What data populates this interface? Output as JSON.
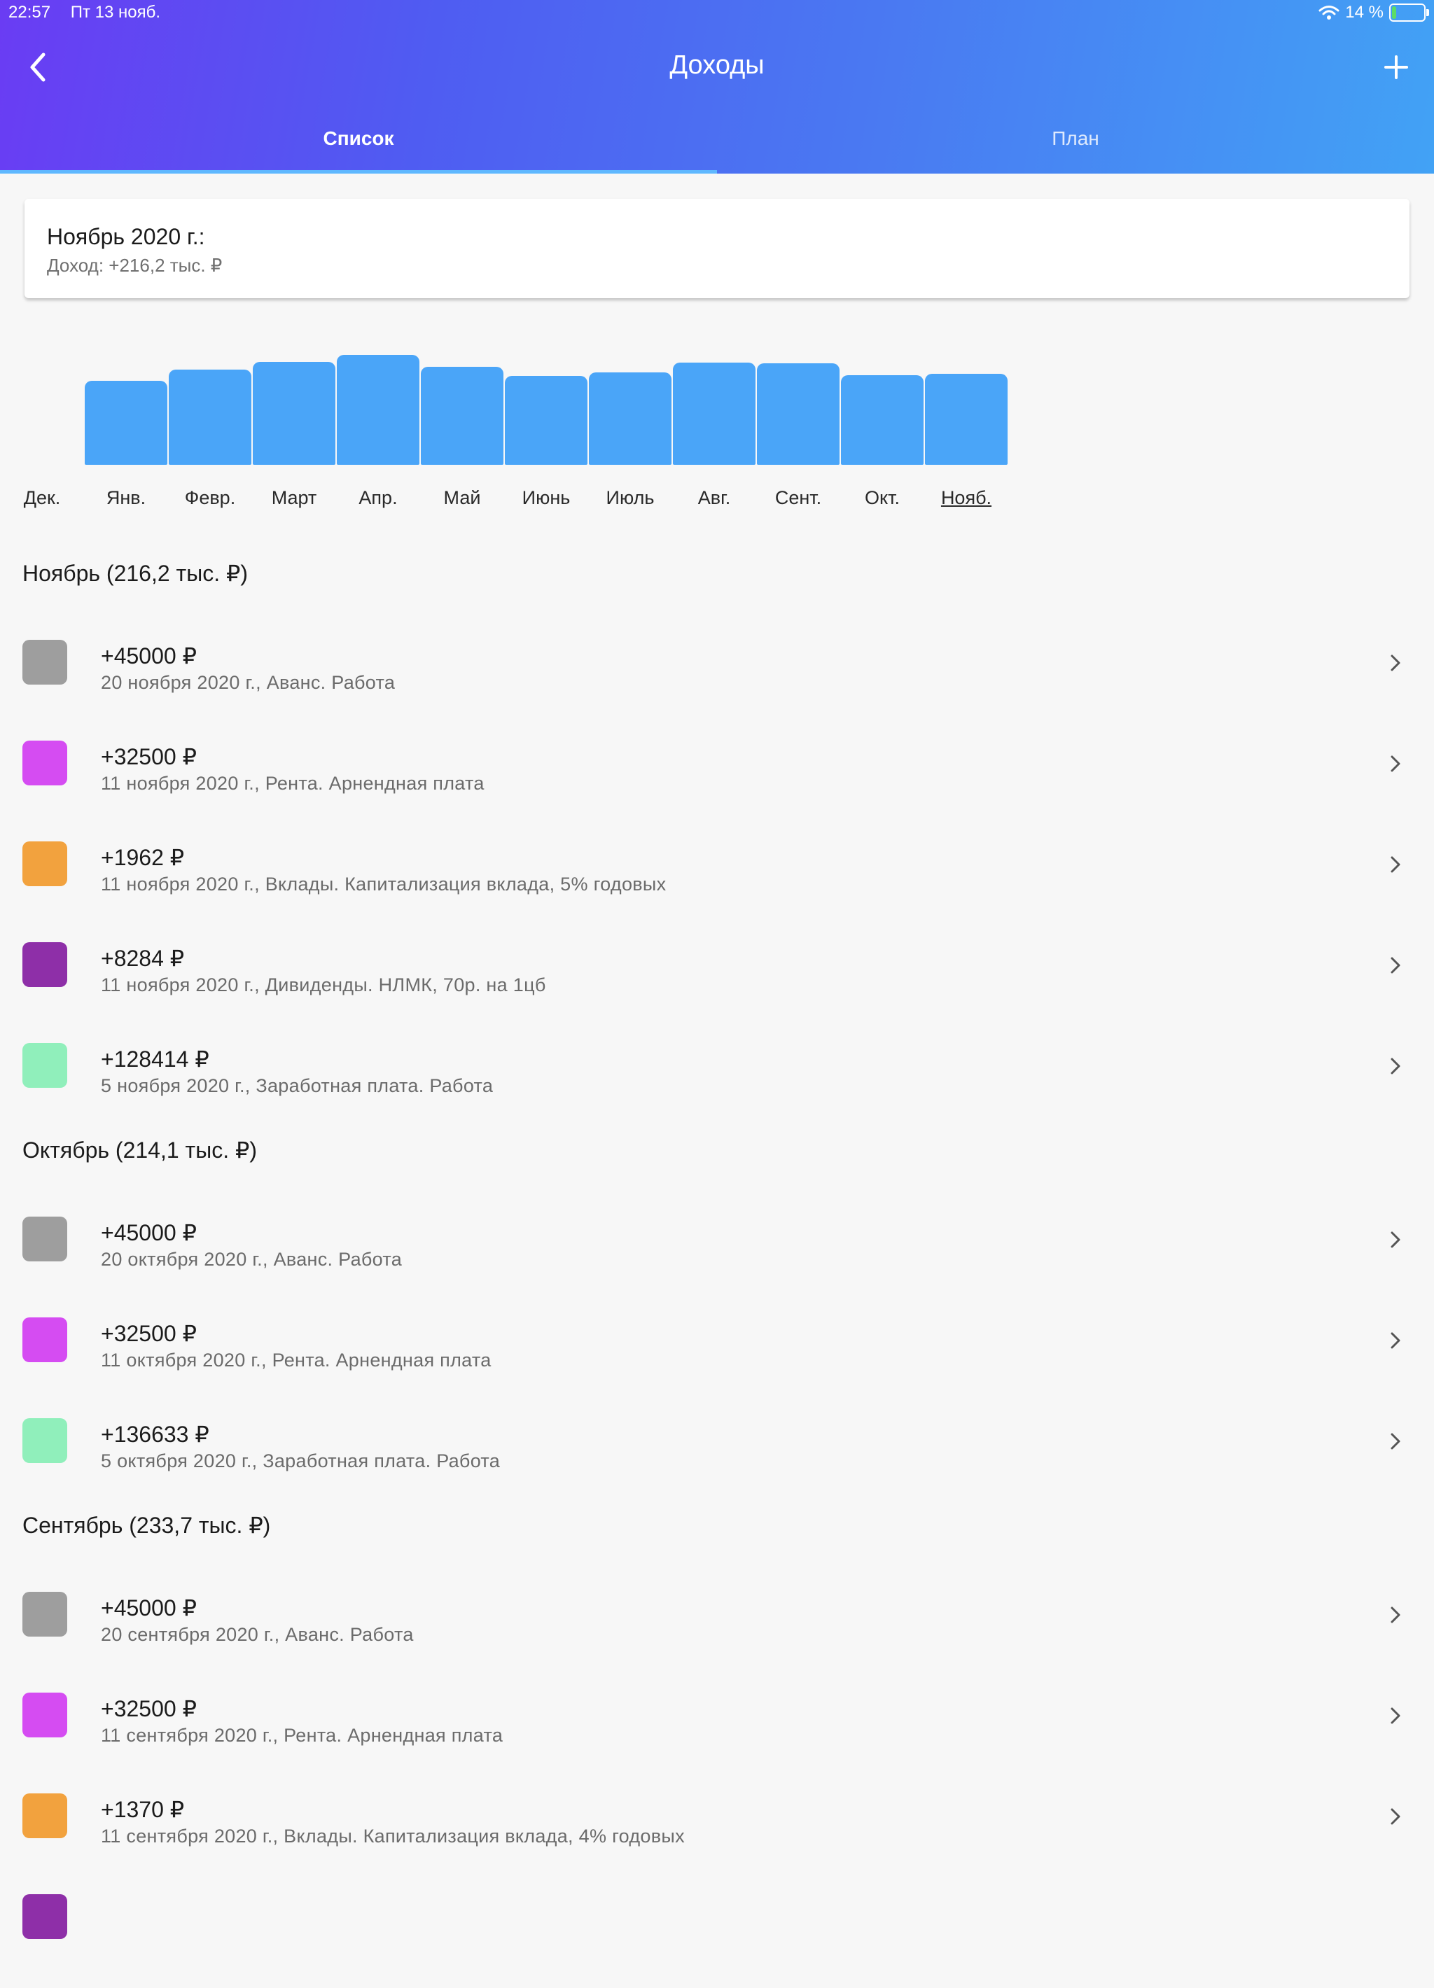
{
  "status": {
    "time": "22:57",
    "date": "Пт 13 нояб.",
    "battery": "14 %",
    "battery_level": 0.14
  },
  "nav": {
    "title": "Доходы"
  },
  "tabs": [
    {
      "label": "Список",
      "active": true
    },
    {
      "label": "План",
      "active": false
    }
  ],
  "summary": {
    "title": "Ноябрь 2020 г.:",
    "income": "Доход: +216,2 тыс. ₽"
  },
  "chart_data": {
    "type": "bar",
    "categories": [
      "Дек.",
      "Янв.",
      "Февр.",
      "Март",
      "Апр.",
      "Май",
      "Июнь",
      "Июль",
      "Авг.",
      "Сент.",
      "Окт.",
      "Нояб."
    ],
    "values": [
      0,
      200,
      226,
      245,
      262,
      233,
      212,
      220,
      244,
      241,
      214,
      216.2
    ],
    "selected": "Нояб.",
    "ylim": [
      0,
      270
    ],
    "color": "#4aa5f8"
  },
  "colors": {
    "avans": "#9e9e9e",
    "renta": "#d54cf2",
    "vklady": "#f2a23e",
    "dividendy": "#8e2fa8",
    "zarplata": "#90efbb"
  },
  "sections": [
    {
      "title": "Ноябрь (216,2 тыс. ₽)",
      "items": [
        {
          "amount": "+45000 ₽",
          "desc": "20 ноября 2020 г., Аванс. Работа",
          "color": "#9e9e9e"
        },
        {
          "amount": "+32500 ₽",
          "desc": "11 ноября 2020 г., Рента. Арнендная плата",
          "color": "#d54cf2"
        },
        {
          "amount": "+1962 ₽",
          "desc": "11 ноября 2020 г., Вклады. Капитализация вклада, 5% годовых",
          "color": "#f2a23e"
        },
        {
          "amount": "+8284 ₽",
          "desc": "11 ноября 2020 г., Дивиденды. НЛМК, 70р. на 1цб",
          "color": "#8e2fa8"
        },
        {
          "amount": "+128414 ₽",
          "desc": "5 ноября 2020 г., Заработная плата. Работа",
          "color": "#90efbb"
        }
      ]
    },
    {
      "title": "Октябрь (214,1 тыс. ₽)",
      "items": [
        {
          "amount": "+45000 ₽",
          "desc": "20 октября 2020 г., Аванс. Работа",
          "color": "#9e9e9e"
        },
        {
          "amount": "+32500 ₽",
          "desc": "11 октября 2020 г., Рента. Арнендная плата",
          "color": "#d54cf2"
        },
        {
          "amount": "+136633 ₽",
          "desc": "5 октября 2020 г., Заработная плата. Работа",
          "color": "#90efbb"
        }
      ]
    },
    {
      "title": "Сентябрь (233,7 тыс. ₽)",
      "items": [
        {
          "amount": "+45000 ₽",
          "desc": "20 сентября 2020 г., Аванс. Работа",
          "color": "#9e9e9e"
        },
        {
          "amount": "+32500 ₽",
          "desc": "11 сентября 2020 г., Рента. Арнендная плата",
          "color": "#d54cf2"
        },
        {
          "amount": "+1370 ₽",
          "desc": "11 сентября 2020 г., Вклады. Капитализация вклада, 4% годовых",
          "color": "#f2a23e"
        },
        {
          "amount": "",
          "desc": "",
          "color": "#8e2fa8"
        }
      ]
    }
  ]
}
